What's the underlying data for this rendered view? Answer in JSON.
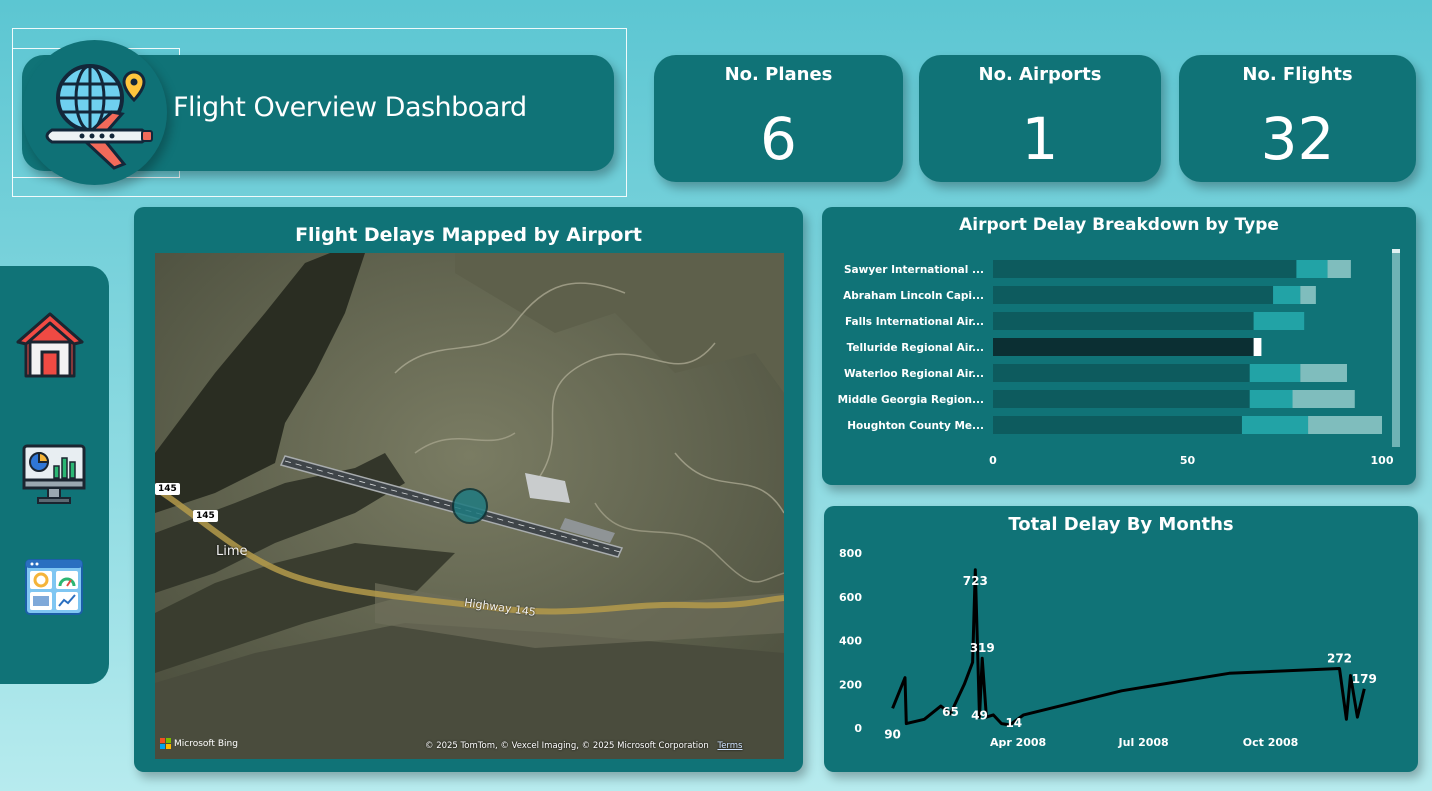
{
  "header": {
    "title": "Flight Overview Dashboard",
    "logo_icon": "globe-airplane-icon"
  },
  "kpis": {
    "planes": {
      "label": "No. Planes",
      "value": "6"
    },
    "airports": {
      "label": "No. Airports",
      "value": "1"
    },
    "flights": {
      "label": "No. Flights",
      "value": "32"
    }
  },
  "sidebar": {
    "items": [
      {
        "icon": "home-icon"
      },
      {
        "icon": "monitor-chart-icon"
      },
      {
        "icon": "dashboard-gauge-icon"
      }
    ]
  },
  "map": {
    "title": "Flight Delays Mapped by Airport",
    "labels": {
      "place": "Lime",
      "highway": "Highway 145",
      "shield1": "145",
      "shield2": "145"
    },
    "attribution": "© 2025 TomTom, © Vexcel Imaging, © 2025 Microsoft Corporation",
    "terms": "Terms",
    "provider": "Microsoft Bing"
  },
  "colors": {
    "card": "#107377",
    "dark": "#0d5b5e",
    "mid": "#22a3a6",
    "light": "#7fbdbd",
    "highlight": "#0b2f33"
  },
  "chart_data": [
    {
      "type": "bar",
      "orientation": "horizontal",
      "stacked": true,
      "title": "Airport Delay Breakdown by Type",
      "categories": [
        "Sawyer International ...",
        "Abraham Lincoln Capi...",
        "Falls International Air...",
        "Telluride Regional Air...",
        "Waterloo Regional Air...",
        "Middle Georgia Region...",
        "Houghton County Me..."
      ],
      "series": [
        {
          "values": [
            78,
            72,
            67,
            67,
            66,
            66,
            64
          ]
        },
        {
          "values": [
            8,
            7,
            13,
            2,
            13,
            11,
            17
          ]
        },
        {
          "values": [
            6,
            4,
            0,
            0,
            12,
            16,
            19
          ]
        }
      ],
      "highlight_index": 3,
      "xlim": [
        0,
        100
      ],
      "xticks": [
        0,
        50,
        100
      ]
    },
    {
      "type": "line",
      "title": "Total Delay By Months",
      "x_ticks": [
        "Apr 2008",
        "Jul 2008",
        "Oct 2008"
      ],
      "y_ticks": [
        0,
        200,
        400,
        600,
        800
      ],
      "ylim": [
        0,
        800
      ],
      "points": [
        {
          "x": "2008-01-01",
          "y": 90
        },
        {
          "x": "2008-01-10",
          "y": 230
        },
        {
          "x": "2008-01-11",
          "y": 20
        },
        {
          "x": "2008-01-24",
          "y": 40
        },
        {
          "x": "2008-02-05",
          "y": 100
        },
        {
          "x": "2008-02-12",
          "y": 65
        },
        {
          "x": "2008-02-22",
          "y": 200
        },
        {
          "x": "2008-02-28",
          "y": 300
        },
        {
          "x": "2008-03-01",
          "y": 723
        },
        {
          "x": "2008-03-04",
          "y": 49
        },
        {
          "x": "2008-03-06",
          "y": 319
        },
        {
          "x": "2008-03-09",
          "y": 50
        },
        {
          "x": "2008-03-14",
          "y": 60
        },
        {
          "x": "2008-03-20",
          "y": 20
        },
        {
          "x": "2008-03-26",
          "y": 14
        },
        {
          "x": "2008-04-05",
          "y": 60
        },
        {
          "x": "2008-06-15",
          "y": 170
        },
        {
          "x": "2008-09-01",
          "y": 250
        },
        {
          "x": "2008-11-20",
          "y": 272
        },
        {
          "x": "2008-11-25",
          "y": 40
        },
        {
          "x": "2008-11-28",
          "y": 240
        },
        {
          "x": "2008-12-03",
          "y": 50
        },
        {
          "x": "2008-12-08",
          "y": 179
        }
      ],
      "data_labels": [
        {
          "x": "2008-01-01",
          "text": "90"
        },
        {
          "x": "2008-02-12",
          "text": "65"
        },
        {
          "x": "2008-03-01",
          "text": "723"
        },
        {
          "x": "2008-03-04",
          "text": "49"
        },
        {
          "x": "2008-03-06",
          "text": "319"
        },
        {
          "x": "2008-03-26",
          "text": "14"
        },
        {
          "x": "2008-11-20",
          "text": "272"
        },
        {
          "x": "2008-12-08",
          "text": "179"
        }
      ]
    }
  ]
}
